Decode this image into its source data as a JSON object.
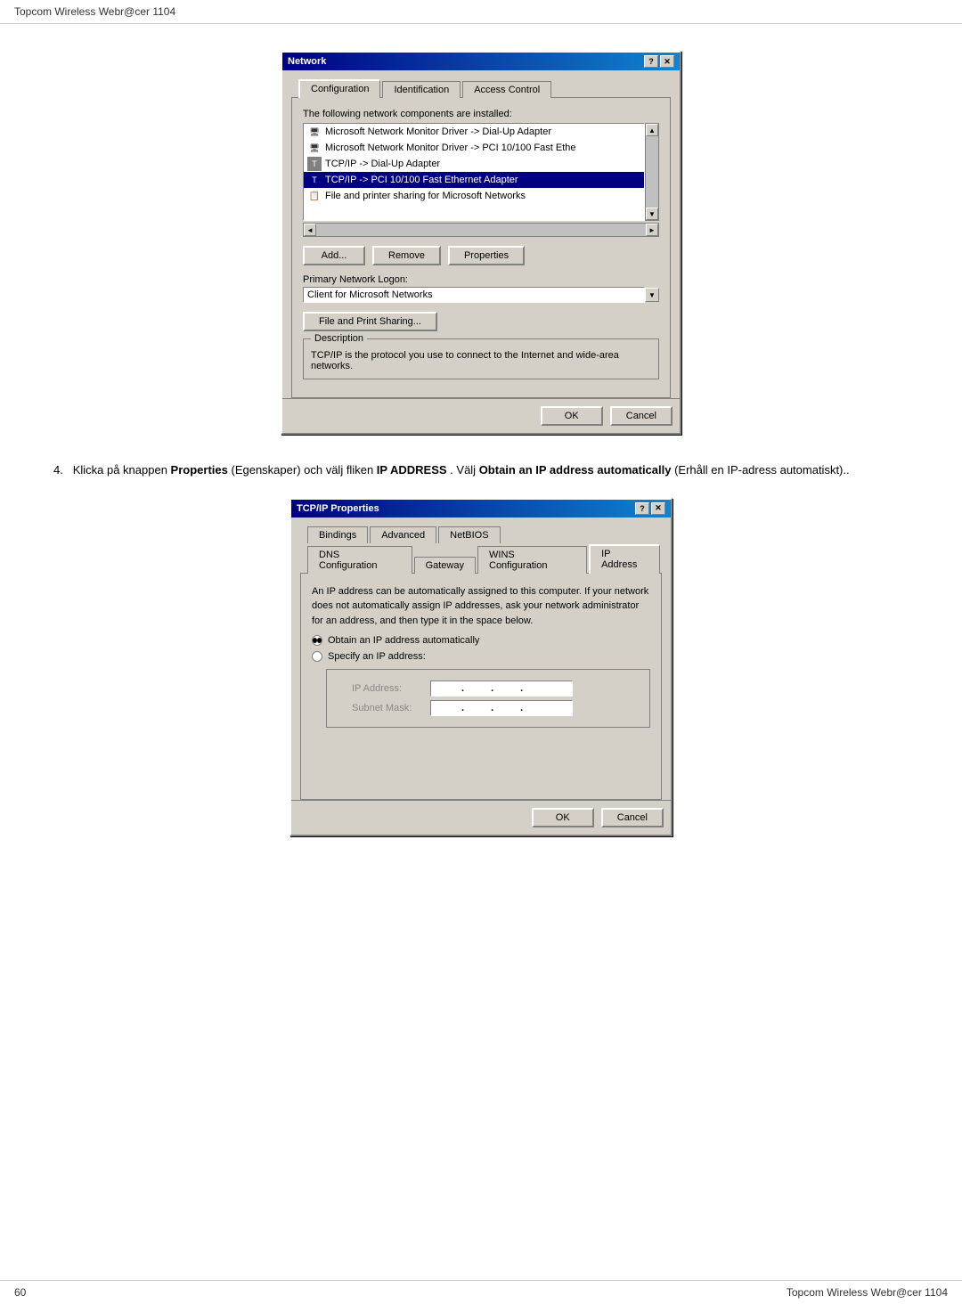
{
  "header": {
    "title": "Topcom Wireless Webr@cer 1104"
  },
  "footer": {
    "page_number": "60",
    "right_text": "Topcom Wireless Webr@cer 1104"
  },
  "step4": {
    "number": "4.",
    "text": "Klicka på knappen ",
    "bold1": "Properties",
    "text2": " (Egenskaper) och välj fliken ",
    "bold2": "IP ADDRESS",
    "text3": ". Välj ",
    "bold3": "Obtain an IP address automatically",
    "text4": " (Erhåll en IP-adress automatiskt).."
  },
  "network_dialog": {
    "title": "Network",
    "title_icon": "?",
    "close_btn": "✕",
    "tabs": [
      {
        "label": "Configuration",
        "active": true
      },
      {
        "label": "Identification",
        "active": false
      },
      {
        "label": "Access Control",
        "active": false
      }
    ],
    "components_label": "The following network components are installed:",
    "components": [
      {
        "icon": "monitor",
        "text": "Microsoft Network Monitor Driver -> Dial-Up Adapter",
        "selected": false
      },
      {
        "icon": "monitor",
        "text": "Microsoft Network Monitor Driver -> PCI 10/100 Fast Ethe",
        "selected": false
      },
      {
        "icon": "tcp",
        "text": "TCP/IP -> Dial-Up Adapter",
        "selected": false
      },
      {
        "icon": "tcp",
        "text": "TCP/IP -> PCI 10/100 Fast Ethernet Adapter",
        "selected": true
      },
      {
        "icon": "share",
        "text": "File and printer sharing for Microsoft Networks",
        "selected": false
      }
    ],
    "buttons": {
      "add": "Add...",
      "remove": "Remove",
      "properties": "Properties"
    },
    "primary_network_logon_label": "Primary Network Logon:",
    "primary_network_logon_value": "Client for Microsoft Networks",
    "file_print_sharing_btn": "File and Print Sharing...",
    "description_label": "Description",
    "description_text": "TCP/IP is the protocol you use to connect to the Internet and wide-area networks.",
    "ok_btn": "OK",
    "cancel_btn": "Cancel"
  },
  "tcpip_dialog": {
    "title": "TCP/IP Properties",
    "title_icon": "?",
    "close_btn": "✕",
    "tabs_row1": [
      {
        "label": "Bindings",
        "active": false
      },
      {
        "label": "Advanced",
        "active": false
      },
      {
        "label": "NetBIOS",
        "active": false
      }
    ],
    "tabs_row2": [
      {
        "label": "DNS Configuration",
        "active": false
      },
      {
        "label": "Gateway",
        "active": false
      },
      {
        "label": "WINS Configuration",
        "active": false
      },
      {
        "label": "IP Address",
        "active": true
      }
    ],
    "info_text": "An IP address can be automatically assigned to this computer. If your network does not automatically assign IP addresses, ask your network administrator for an address, and then type it in the space below.",
    "radio1": {
      "label": "Obtain an IP address automatically",
      "selected": true
    },
    "radio2": {
      "label": "Specify an IP address:",
      "selected": false
    },
    "ip_address_label": "IP Address:",
    "subnet_mask_label": "Subnet Mask:",
    "ok_btn": "OK",
    "cancel_btn": "Cancel"
  }
}
